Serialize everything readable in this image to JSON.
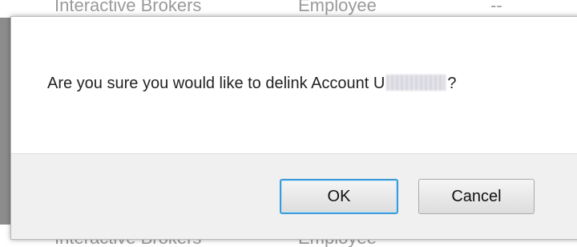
{
  "background_page": {
    "top_row": {
      "col1": "Interactive Brokers",
      "col2": "Employee",
      "col3": "--"
    },
    "bottom_row": {
      "col1": "Interactive Brokers",
      "col2": "Employee"
    }
  },
  "dialog": {
    "message_prefix": "Are you sure you would like to delink Account U",
    "message_suffix": "?",
    "ok_label": "OK",
    "cancel_label": "Cancel"
  },
  "colors": {
    "ok_focus_border": "#3c9bd6",
    "footer_bg": "#f0f0f0"
  }
}
